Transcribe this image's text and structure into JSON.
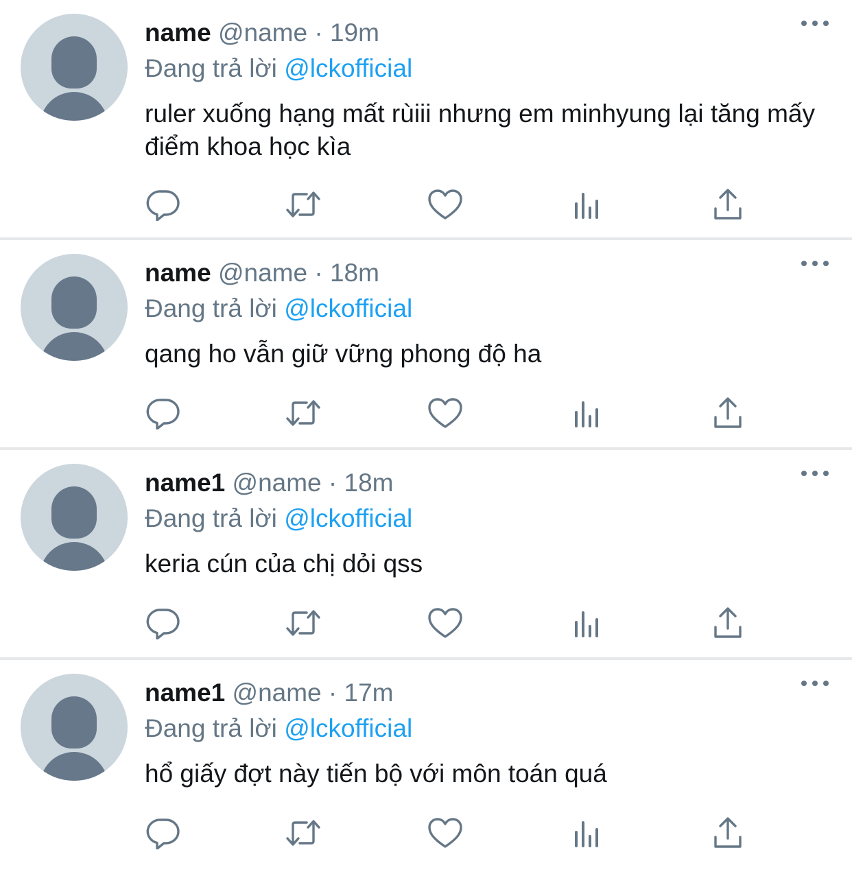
{
  "tweets": [
    {
      "display_name": "name",
      "handle": "@name",
      "time": "19m",
      "reply_prefix": "Đang trả lời",
      "reply_to": "@lckofficial",
      "text": "ruler xuống hạng mất rùiii nhưng em minhyung lại tăng mấy điểm khoa học kìa"
    },
    {
      "display_name": "name",
      "handle": "@name",
      "time": "18m",
      "reply_prefix": "Đang trả lời",
      "reply_to": "@lckofficial",
      "text": "qang ho vẫn giữ vững phong độ ha"
    },
    {
      "display_name": "name1",
      "handle": "@name",
      "time": "18m",
      "reply_prefix": "Đang trả lời",
      "reply_to": "@lckofficial",
      "text": "keria cún của chị dỏi qss"
    },
    {
      "display_name": "name1",
      "handle": "@name",
      "time": "17m",
      "reply_prefix": "Đang trả lời",
      "reply_to": "@lckofficial",
      "text": "hổ giấy đợt này tiến bộ với môn toán quá"
    }
  ],
  "separator": "·",
  "icons": [
    "reply-icon",
    "retweet-icon",
    "like-icon",
    "analytics-icon",
    "share-icon",
    "more-icon",
    "default-avatar"
  ],
  "colors": {
    "name": "#14171a",
    "secondary": "#657786",
    "mention": "#1da1f2",
    "avatar_bg": "#ccd6dd",
    "avatar_fg": "#66788a",
    "divider": "#e6e8ea"
  }
}
